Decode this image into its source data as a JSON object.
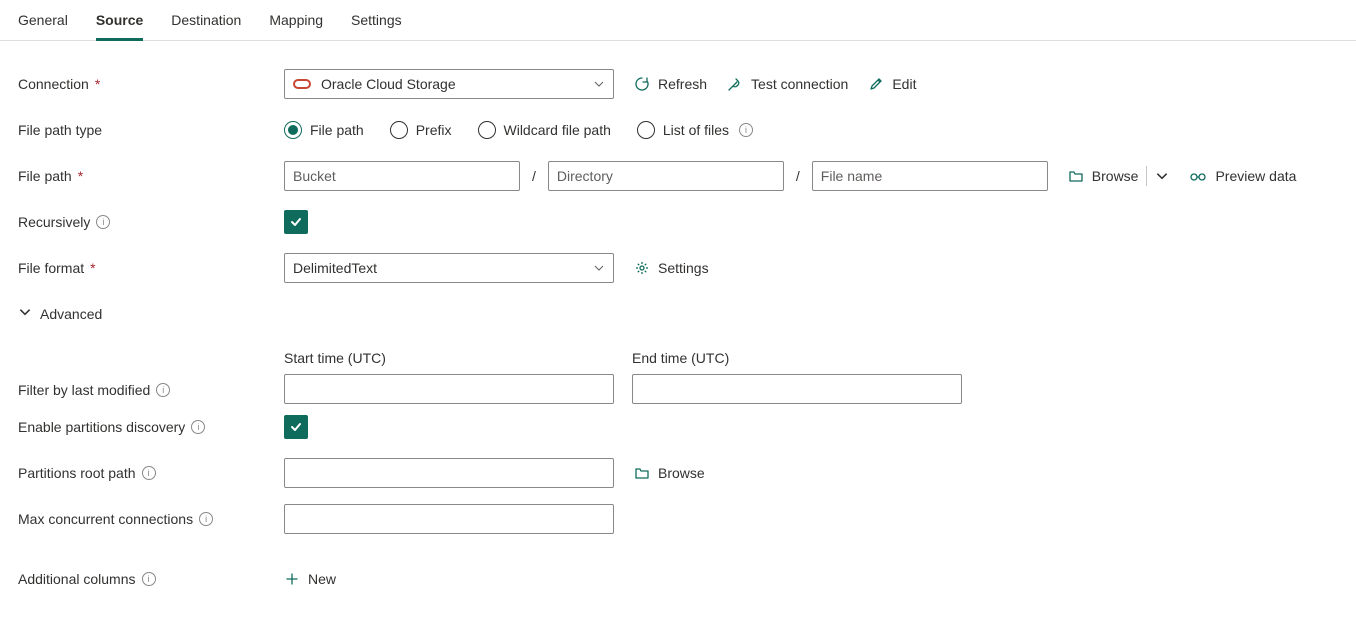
{
  "tabs": [
    "General",
    "Source",
    "Destination",
    "Mapping",
    "Settings"
  ],
  "activeTab": "Source",
  "labels": {
    "connection": "Connection",
    "filePathType": "File path type",
    "filePath": "File path",
    "recursively": "Recursively",
    "fileFormat": "File format",
    "advanced": "Advanced",
    "startTime": "Start time (UTC)",
    "endTime": "End time (UTC)",
    "filterByLastModified": "Filter by last modified",
    "enablePartitions": "Enable partitions discovery",
    "partitionsRootPath": "Partitions root path",
    "maxConcurrent": "Max concurrent connections",
    "additionalColumns": "Additional columns"
  },
  "connection": {
    "value": "Oracle Cloud Storage",
    "actions": {
      "refresh": "Refresh",
      "test": "Test connection",
      "edit": "Edit"
    }
  },
  "filePathType": {
    "options": [
      "File path",
      "Prefix",
      "Wildcard file path",
      "List of files"
    ],
    "selected": "File path"
  },
  "filePath": {
    "placeholders": {
      "bucket": "Bucket",
      "directory": "Directory",
      "file": "File name"
    },
    "browse": "Browse",
    "preview": "Preview data"
  },
  "fileFormat": {
    "value": "DelimitedText",
    "settings": "Settings"
  },
  "partitions": {
    "browse": "Browse"
  },
  "newAction": "New"
}
